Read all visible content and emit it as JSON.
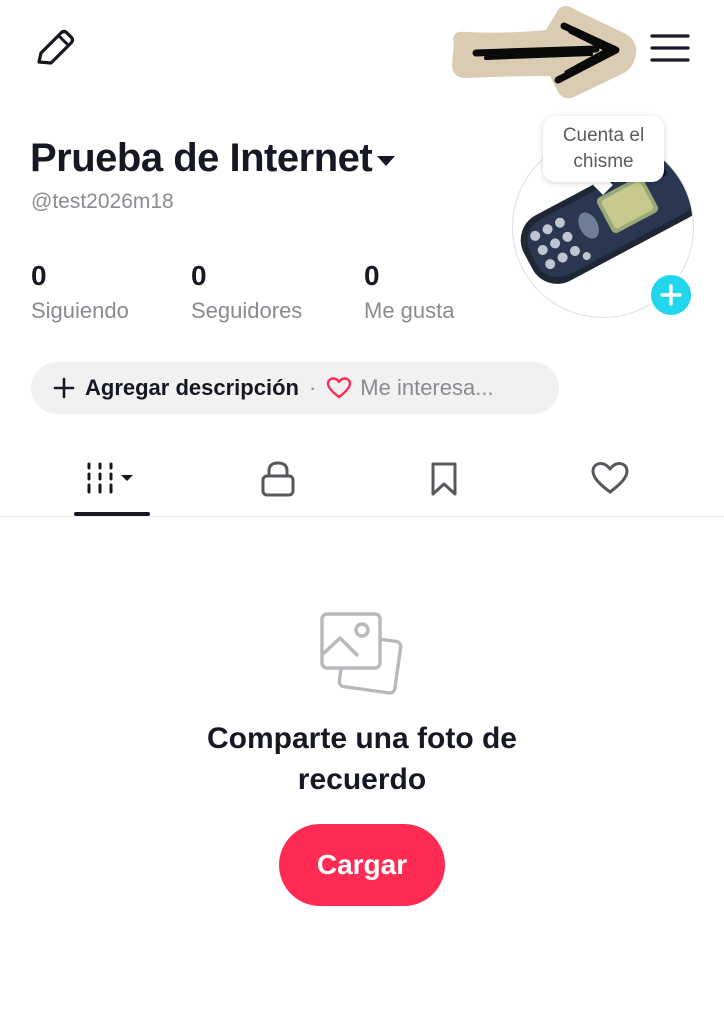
{
  "header": {
    "edit_icon": "pencil-icon",
    "menu_icon": "hamburger-menu-icon",
    "annotation": "arrow-pointing-to-menu"
  },
  "profile": {
    "name": "Prueba de Internet",
    "handle": "@test2026m18",
    "avatar_tooltip_line1": "Cuenta el",
    "avatar_tooltip_line2": "chisme",
    "avatar_image": "nokia-phone-photo",
    "add_avatar_icon": "plus-icon"
  },
  "stats": [
    {
      "value": "0",
      "label": "Siguiendo"
    },
    {
      "value": "0",
      "label": "Seguidores"
    },
    {
      "value": "0",
      "label": "Me gusta"
    }
  ],
  "description": {
    "add_label": "Agregar descripción",
    "separator": "·",
    "interest_label": "Me interesa..."
  },
  "tabs": [
    {
      "icon": "grid-videos-icon",
      "active": true
    },
    {
      "icon": "lock-icon",
      "active": false
    },
    {
      "icon": "bookmark-icon",
      "active": false
    },
    {
      "icon": "heart-outline-icon",
      "active": false
    }
  ],
  "empty_state": {
    "icon": "photos-icon",
    "title": "Comparte una foto de recuerdo",
    "button_label": "Cargar"
  },
  "colors": {
    "primary_text": "#161823",
    "secondary_text": "#8a8b91",
    "brand_red": "#fe2c55",
    "avatar_add": "#20d5ec",
    "pill_bg": "#f1f1f2",
    "heart_red": "#fe2c55"
  }
}
